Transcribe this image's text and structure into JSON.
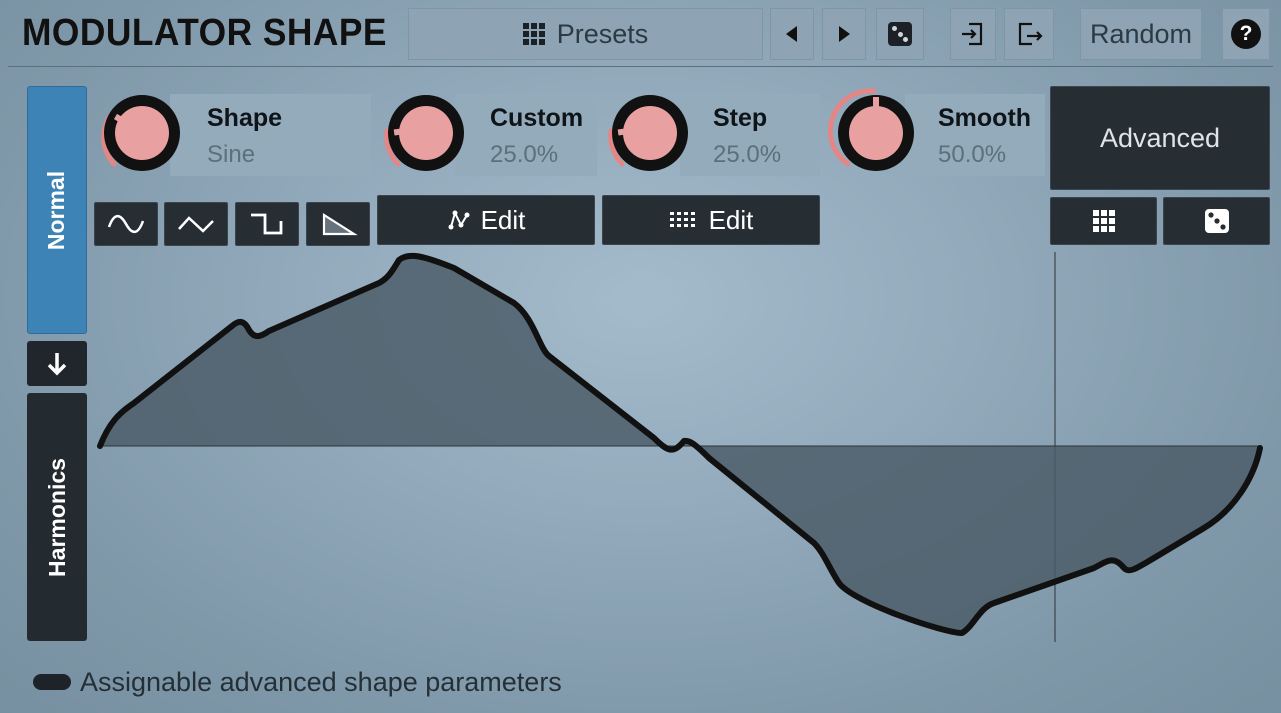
{
  "header": {
    "title": "MODULATOR SHAPE",
    "presets_label": "Presets",
    "random_label": "Random",
    "help_label": "?"
  },
  "tabs": {
    "normal": "Normal",
    "harmonics": "Harmonics"
  },
  "knobs": [
    {
      "label": "Shape",
      "value": "Sine"
    },
    {
      "label": "Custom",
      "value": "25.0%"
    },
    {
      "label": "Step",
      "value": "25.0%"
    },
    {
      "label": "Smooth",
      "value": "50.0%"
    }
  ],
  "buttons": {
    "advanced": "Advanced",
    "edit_custom": "Edit",
    "edit_step": "Edit"
  },
  "footer": {
    "assignable_label": "Assignable advanced shape parameters"
  },
  "colors": {
    "accent_tab": "#3d83b6",
    "knob_arc": "#e58686",
    "knob_face": "#e8a0a0",
    "dark_button": "#262d33"
  },
  "icons": [
    "grid-icon",
    "prev-icon",
    "next-icon",
    "dice-icon",
    "import-icon",
    "export-icon",
    "help-icon",
    "down-arrow-icon",
    "sine-shape-icon",
    "triangle-shape-icon",
    "square-shape-icon",
    "saw-shape-icon",
    "custom-edit-icon",
    "step-edit-icon"
  ]
}
